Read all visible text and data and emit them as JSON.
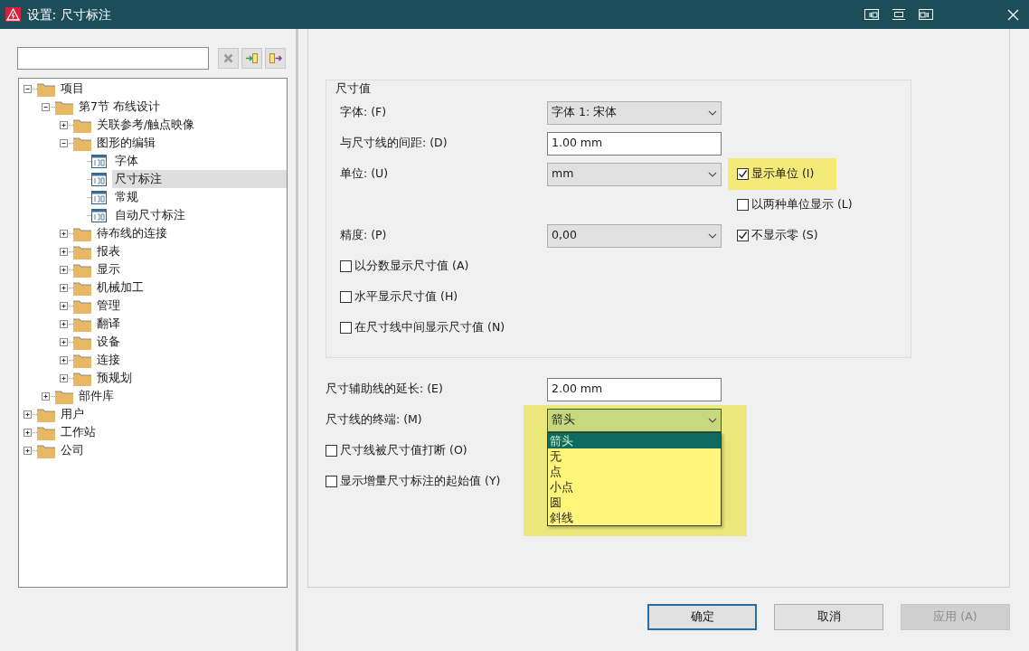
{
  "window": {
    "title": "设置: 尺寸标注"
  },
  "tree": [
    {
      "label": "项目",
      "kind": "folder",
      "expanded": true,
      "selected": false,
      "children": [
        {
          "label": "第7节 布线设计",
          "kind": "folder",
          "expanded": true,
          "selected": false,
          "children": [
            {
              "label": "关联参考/触点映像",
              "kind": "folder",
              "expanded": false,
              "selected": false
            },
            {
              "label": "图形的编辑",
              "kind": "folder",
              "expanded": true,
              "selected": false,
              "children": [
                {
                  "label": "字体",
                  "kind": "page",
                  "selected": false
                },
                {
                  "label": "尺寸标注",
                  "kind": "page",
                  "selected": true
                },
                {
                  "label": "常规",
                  "kind": "page",
                  "selected": false
                },
                {
                  "label": "自动尺寸标注",
                  "kind": "page",
                  "selected": false
                }
              ]
            },
            {
              "label": "待布线的连接",
              "kind": "folder",
              "expanded": false,
              "selected": false
            },
            {
              "label": "报表",
              "kind": "folder",
              "expanded": false,
              "selected": false
            },
            {
              "label": "显示",
              "kind": "folder",
              "expanded": false,
              "selected": false
            },
            {
              "label": "机械加工",
              "kind": "folder",
              "expanded": false,
              "selected": false
            },
            {
              "label": "管理",
              "kind": "folder",
              "expanded": false,
              "selected": false
            },
            {
              "label": "翻译",
              "kind": "folder",
              "expanded": false,
              "selected": false
            },
            {
              "label": "设备",
              "kind": "folder",
              "expanded": false,
              "selected": false
            },
            {
              "label": "连接",
              "kind": "folder",
              "expanded": false,
              "selected": false
            },
            {
              "label": "预规划",
              "kind": "folder",
              "expanded": false,
              "selected": false
            }
          ]
        },
        {
          "label": "部件库",
          "kind": "folder",
          "expanded": false,
          "selected": false
        }
      ]
    },
    {
      "label": "用户",
      "kind": "folder",
      "expanded": false,
      "selected": false
    },
    {
      "label": "工作站",
      "kind": "folder",
      "expanded": false,
      "selected": false
    },
    {
      "label": "公司",
      "kind": "folder",
      "expanded": false,
      "selected": false
    }
  ],
  "group": {
    "title": "尺寸值",
    "fields": [
      {
        "kind": "select",
        "label": "字体: (F)",
        "value": "字体 1: 宋体"
      },
      {
        "kind": "text",
        "label": "与尺寸线的间距: (D)",
        "value": "1.00 mm"
      },
      {
        "kind": "select",
        "label": "单位: (U)",
        "value": "mm",
        "side": {
          "label": "显示单位 (I)",
          "checked": true,
          "highlighted": true
        }
      },
      {
        "kind": "empty",
        "side": {
          "label": "以两种单位显示 (L)",
          "checked": false
        }
      },
      {
        "kind": "select",
        "label": "精度: (P)",
        "value": "0,00",
        "side": {
          "label": "不显示零 (S)",
          "checked": true
        }
      },
      {
        "kind": "checkbox",
        "label": "以分数显示尺寸值 (A)",
        "checked": false
      },
      {
        "kind": "checkbox",
        "label": "水平显示尺寸值 (H)",
        "checked": false
      },
      {
        "kind": "checkbox",
        "label": "在尺寸线中间显示尺寸值 (N)",
        "checked": false
      }
    ]
  },
  "fields": [
    {
      "kind": "text",
      "label": "尺寸辅助线的延长: (E)",
      "value": "2.00 mm"
    },
    {
      "kind": "select",
      "label": "尺寸线的终端: (M)",
      "value": "箭头",
      "highlighted": true,
      "open": true,
      "options": [
        {
          "label": "箭头",
          "selected": true
        },
        {
          "label": "无",
          "selected": false
        },
        {
          "label": "点",
          "selected": false
        },
        {
          "label": "小点",
          "selected": false
        },
        {
          "label": "圆",
          "selected": false
        },
        {
          "label": "斜线",
          "selected": false
        }
      ]
    },
    {
      "kind": "checkbox",
      "label": "尺寸线被尺寸值打断 (O)",
      "checked": false
    },
    {
      "kind": "checkbox",
      "label": "显示增量尺寸标注的起始值 (Y)",
      "checked": false
    }
  ],
  "buttons": [
    {
      "label": "确定",
      "default": true,
      "disabled": false
    },
    {
      "label": "取消",
      "default": false,
      "disabled": false
    },
    {
      "label": "应用 (A)",
      "default": false,
      "disabled": true
    }
  ]
}
